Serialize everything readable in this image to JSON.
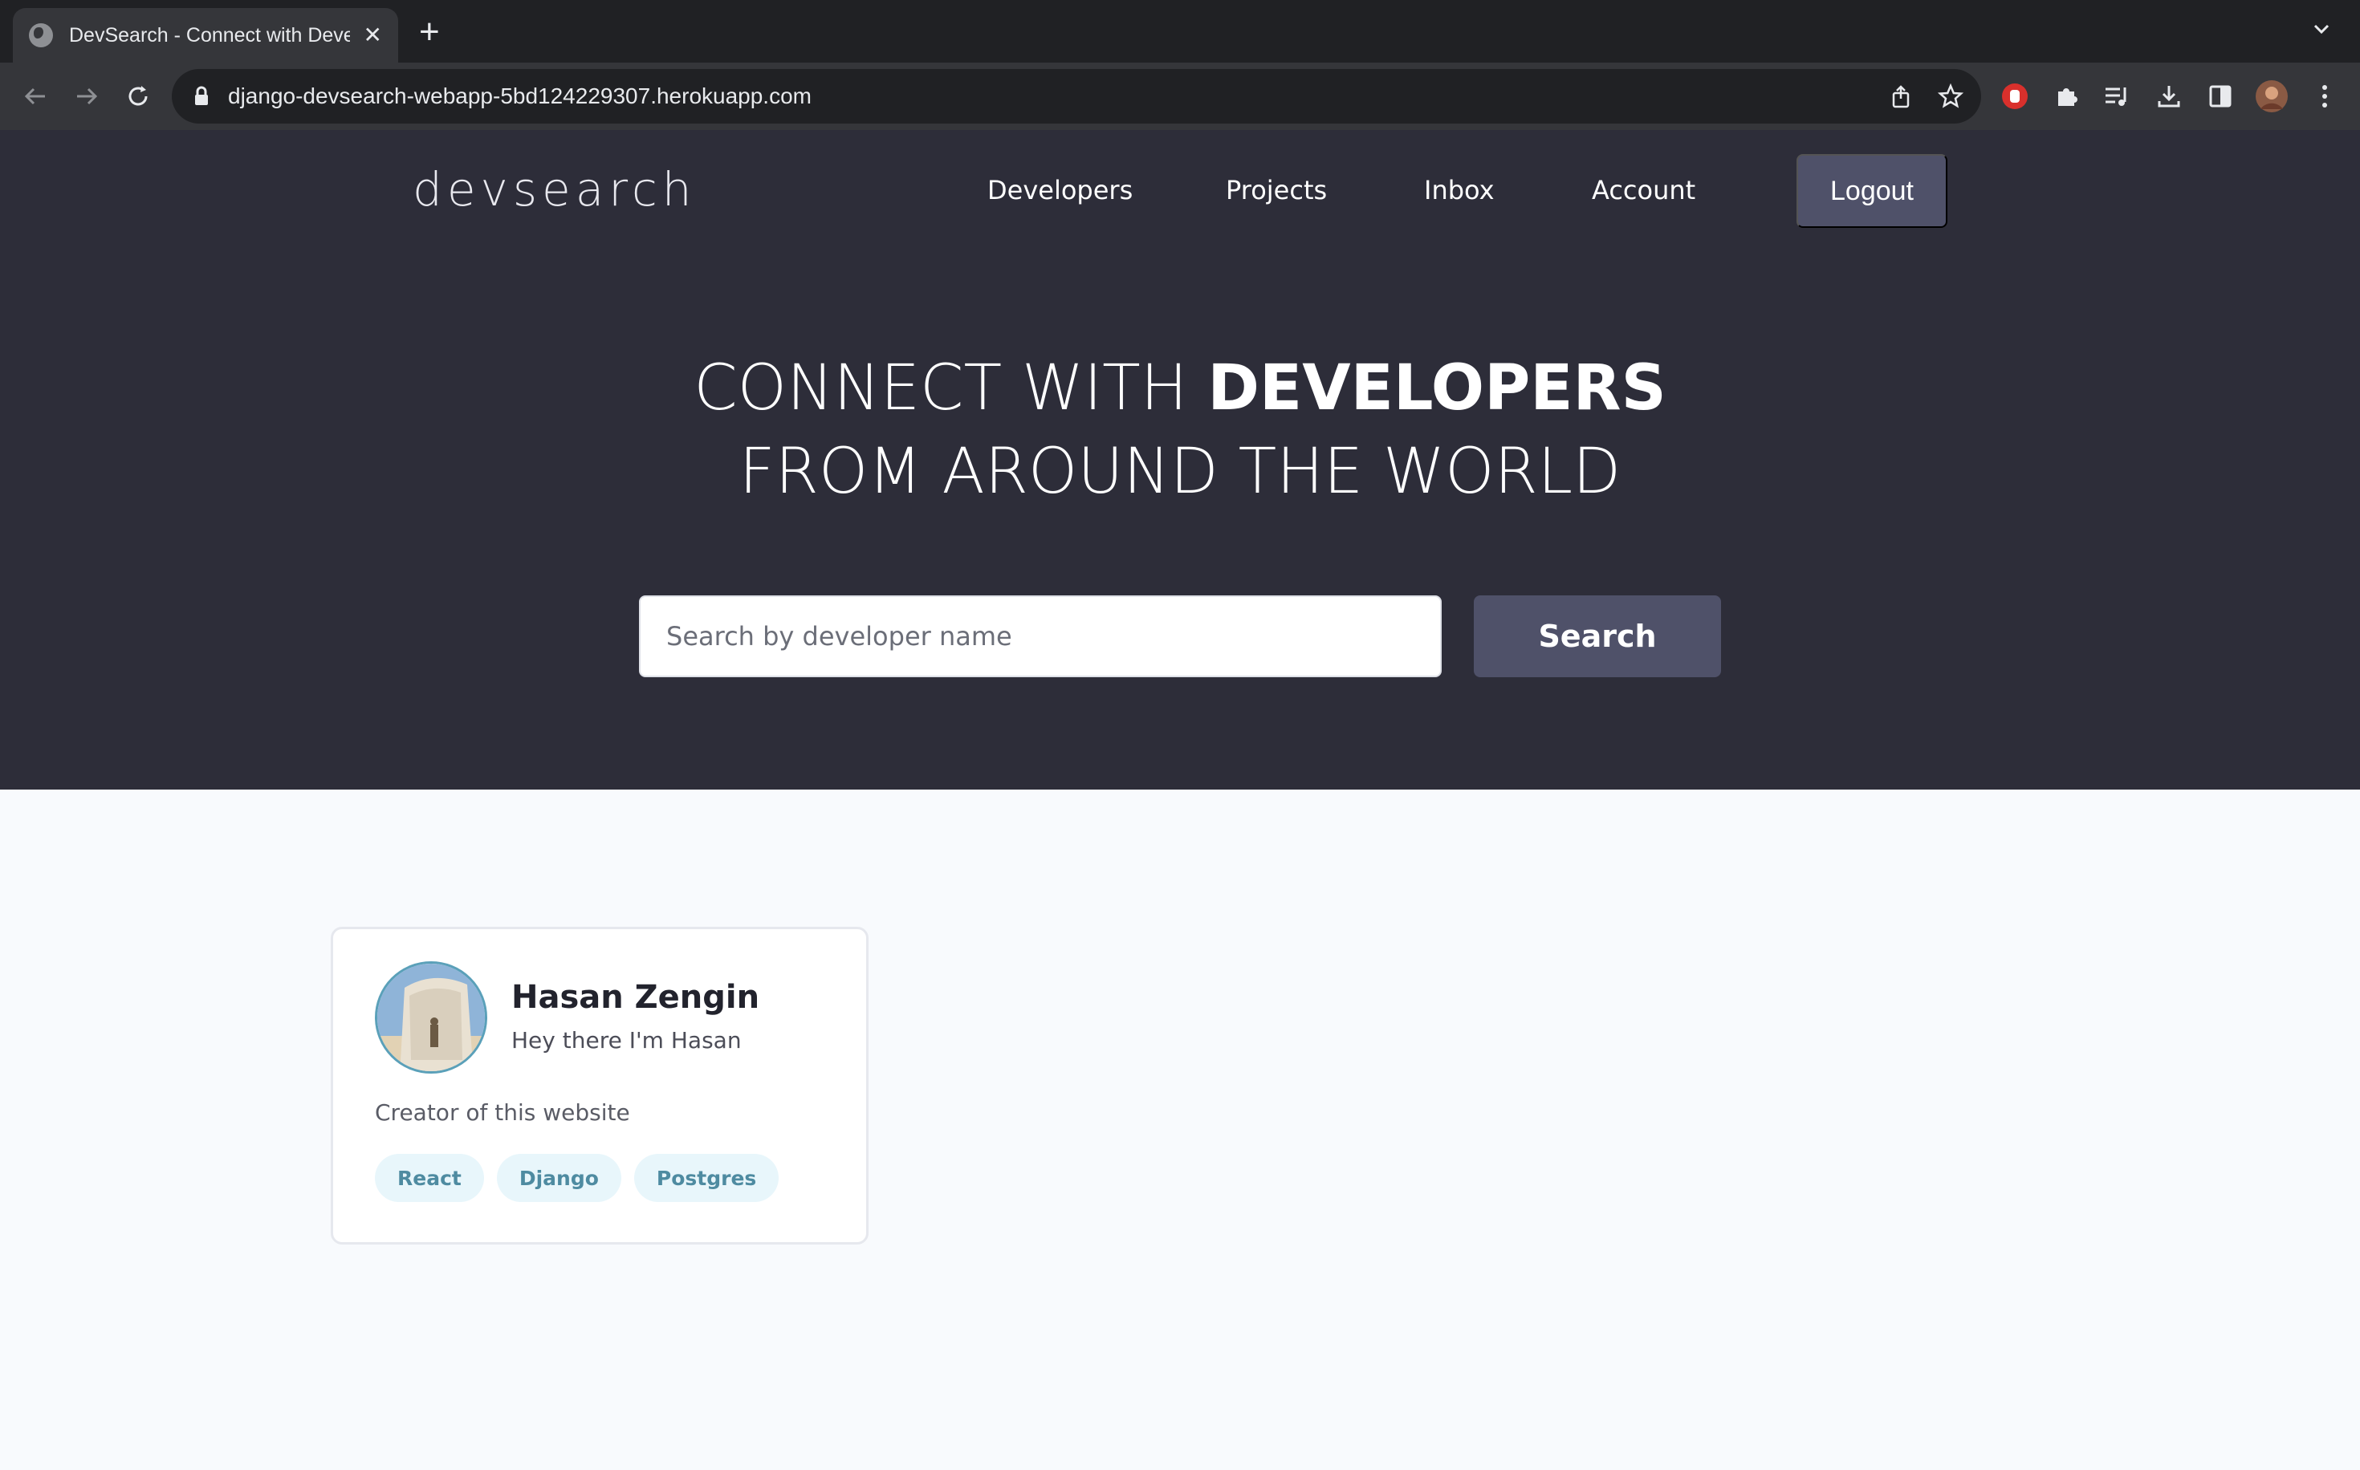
{
  "browser": {
    "tab_title": "DevSearch - Connect with Developers",
    "tab_close": "✕",
    "new_tab": "+",
    "url": "django-devsearch-webapp-5bd124229307.herokuapp.com"
  },
  "navbar": {
    "logo": "devsearch",
    "links": [
      "Developers",
      "Projects",
      "Inbox",
      "Account"
    ],
    "logout_label": "Logout"
  },
  "hero": {
    "line1_regular": "CONNECT WITH ",
    "line1_bold": "DEVELOPERS",
    "line2": "FROM AROUND THE WORLD",
    "search_placeholder": "Search by developer name",
    "search_button": "Search"
  },
  "developers": [
    {
      "name": "Hasan Zengin",
      "headline": "Hey there I'm Hasan",
      "bio": "Creator of this website",
      "skills": [
        "React",
        "Django",
        "Postgres"
      ]
    }
  ],
  "colors": {
    "hero_bg": "#2d2d39",
    "button_bg": "#4f5169",
    "tag_bg": "#e8f6fb",
    "tag_text": "#4e8ba1",
    "page_bg": "#f8fafd"
  },
  "icons": {
    "back": "arrow-left-icon",
    "forward": "arrow-right-icon",
    "reload": "reload-icon",
    "lock": "lock-icon",
    "share": "share-icon",
    "bookmark": "star-icon",
    "extensions": "puzzle-icon",
    "media": "media-queue-icon",
    "download": "download-icon",
    "sidepanel": "side-panel-icon",
    "menu": "kebab-menu-icon"
  }
}
